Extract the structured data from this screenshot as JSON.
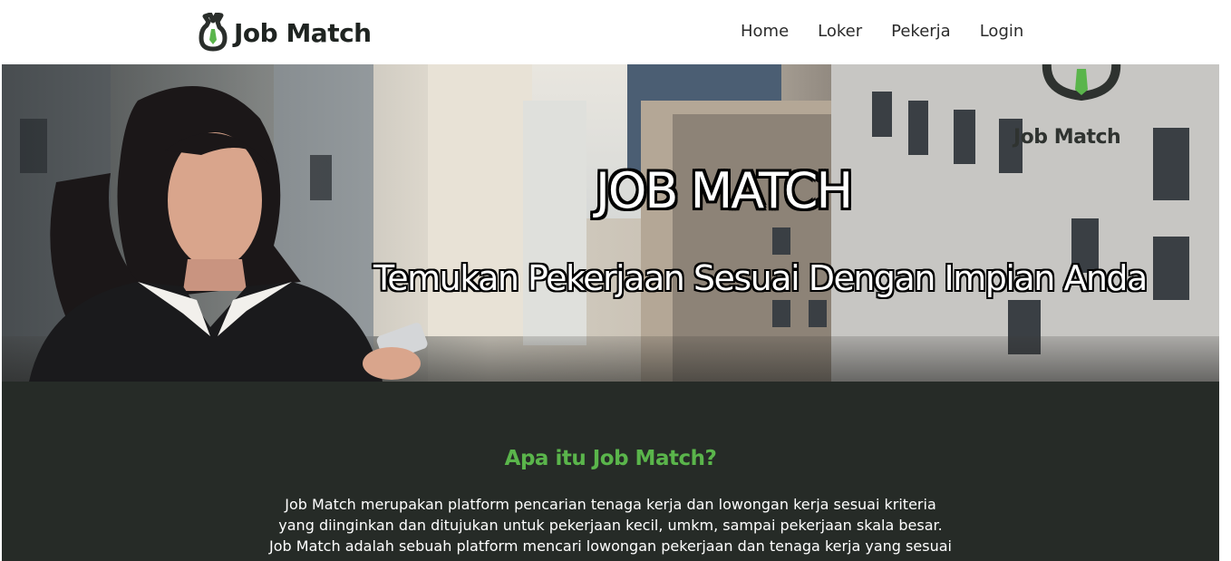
{
  "navbar": {
    "brand": "Job Match",
    "links": [
      "Home",
      "Loker",
      "Pekerja",
      "Login"
    ]
  },
  "hero": {
    "title": "JOB MATCH",
    "subtitle": "Temukan Pekerjaan Sesuai Dengan Impian Anda",
    "watermark": "Job Match"
  },
  "about": {
    "title": "Apa itu Job Match?",
    "lines": [
      "Job Match merupakan platform pencarian tenaga kerja dan lowongan kerja sesuai kriteria",
      "yang diinginkan dan ditujukan untuk pekerjaan kecil, umkm, sampai pekerjaan skala besar.",
      "Job Match adalah sebuah platform mencari lowongan pekerjaan dan tenaga kerja yang sesuai"
    ]
  },
  "colors": {
    "accent_green": "#5ab54b",
    "dark_section": "#262b27",
    "brand_text": "#1f2421"
  },
  "icons": {
    "brand": "hand-ok-tie-icon",
    "watermark": "hand-ok-tie-icon"
  }
}
